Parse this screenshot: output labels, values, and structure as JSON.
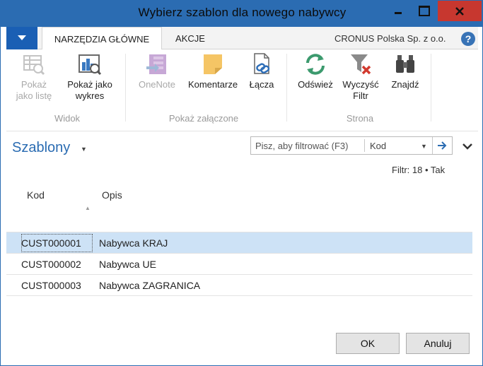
{
  "window": {
    "title": "Wybierz szablon dla nowego nabywcy"
  },
  "ribbon": {
    "tabs": [
      {
        "label": "NARZĘDZIA GŁÓWNE",
        "active": true
      },
      {
        "label": "AKCJE",
        "active": false
      }
    ],
    "company": "CRONUS Polska Sp. z o.o.",
    "help_label": "?",
    "groups": [
      {
        "label": "Widok",
        "buttons": [
          {
            "label_line1": "Pokaż",
            "label_line2": "jako listę",
            "icon": "list-view-icon",
            "enabled": false
          },
          {
            "label_line1": "Pokaż jako",
            "label_line2": "wykres",
            "icon": "chart-view-icon",
            "enabled": true
          }
        ]
      },
      {
        "label": "Pokaż załączone",
        "buttons": [
          {
            "label_line1": "OneNote",
            "icon": "onenote-icon",
            "enabled": false
          },
          {
            "label_line1": "Komentarze",
            "icon": "comments-icon",
            "enabled": true
          },
          {
            "label_line1": "Łącza",
            "icon": "links-icon",
            "enabled": true
          }
        ]
      },
      {
        "label": "Strona",
        "buttons": [
          {
            "label_line1": "Odśwież",
            "icon": "refresh-icon",
            "enabled": true
          },
          {
            "label_line1": "Wyczyść",
            "label_line2": "Filtr",
            "icon": "clear-filter-icon",
            "enabled": true
          },
          {
            "label_line1": "Znajdź",
            "icon": "find-icon",
            "enabled": true
          }
        ]
      }
    ]
  },
  "page": {
    "title": "Szablony",
    "search_placeholder": "Pisz, aby filtrować (F3)",
    "search_field": "Kod",
    "filter_info": "Filtr: 18 • Tak"
  },
  "table": {
    "columns": [
      "Kod",
      "Opis"
    ],
    "rows": [
      {
        "code": "CUST000001",
        "description": "Nabywca KRAJ",
        "selected": true
      },
      {
        "code": "CUST000002",
        "description": "Nabywca UE",
        "selected": false
      },
      {
        "code": "CUST000003",
        "description": "Nabywca ZAGRANICA",
        "selected": false
      }
    ]
  },
  "footer": {
    "ok_label": "OK",
    "cancel_label": "Anuluj"
  },
  "colors": {
    "titlebar": "#2b6cb2",
    "close": "#c7372f",
    "accent": "#2b6cb2",
    "selected_row": "#cde2f6"
  }
}
